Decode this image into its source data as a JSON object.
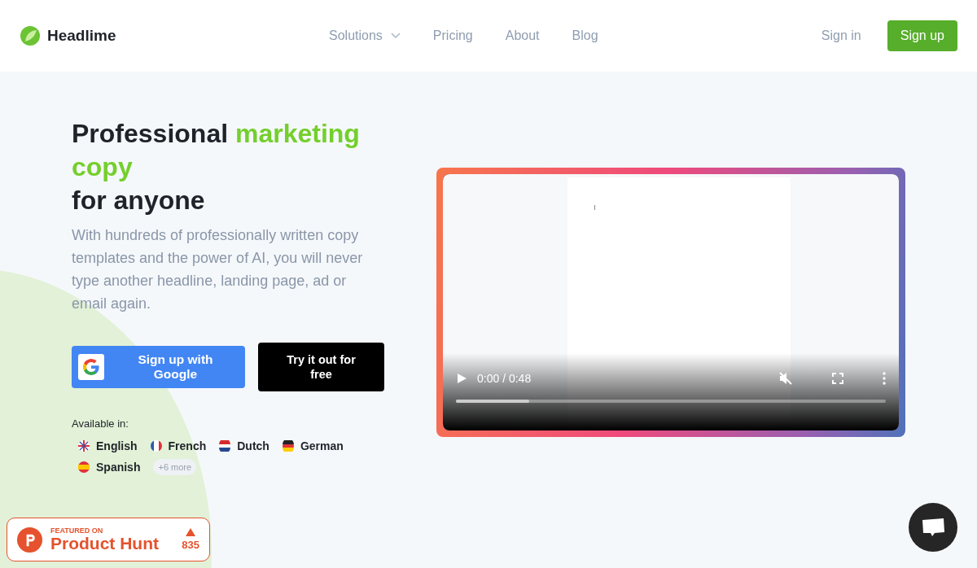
{
  "brand": "Headlime",
  "nav": [
    {
      "label": "Solutions",
      "dropdown": true
    },
    {
      "label": "Pricing",
      "dropdown": false
    },
    {
      "label": "About",
      "dropdown": false
    },
    {
      "label": "Blog",
      "dropdown": false
    }
  ],
  "auth": {
    "sign_in": "Sign in",
    "sign_up": "Sign up"
  },
  "hero": {
    "headline": [
      {
        "text": "Professional ",
        "accent": false,
        "break_before": false
      },
      {
        "text": "marketing copy",
        "accent": true,
        "break_before": false
      },
      {
        "text": "for anyone",
        "accent": false,
        "break_before": true
      }
    ],
    "subtitle": "With hundreds of professionally written copy templates and the power of AI, you will never type another headline, landing page, ad or email again.",
    "google_button": "Sign up with Google",
    "try_button": "Try it out for free",
    "available_label": "Available in:",
    "languages": [
      {
        "name": "English",
        "kind": "uk"
      },
      {
        "name": "French",
        "kind": "fr"
      },
      {
        "name": "Dutch",
        "kind": "nl"
      },
      {
        "name": "German",
        "kind": "de"
      },
      {
        "name": "Spanish",
        "kind": "es"
      }
    ],
    "more": "+6 more"
  },
  "video": {
    "time": "0:00 / 0:48",
    "muted": true,
    "level": 0.17
  },
  "badge": {
    "featured": "FEATURED ON",
    "name": "Product Hunt",
    "votes": "835"
  }
}
